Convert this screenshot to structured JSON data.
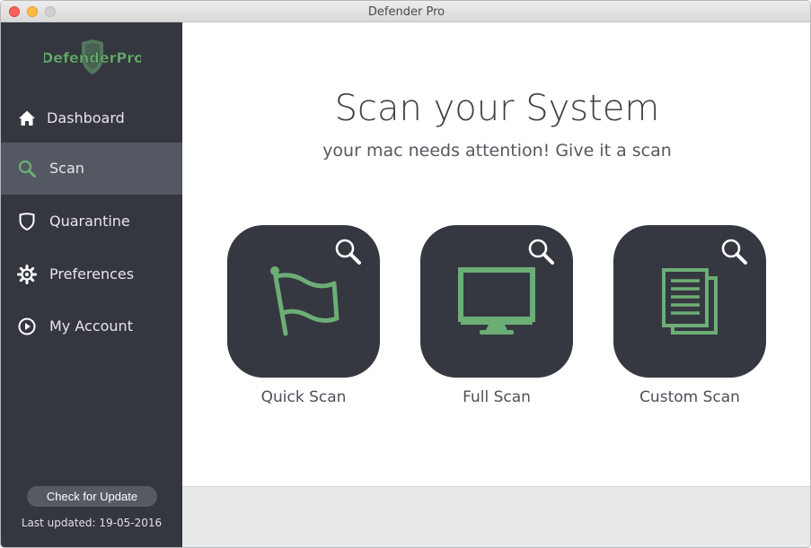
{
  "window": {
    "title": "Defender Pro"
  },
  "brand": {
    "logo_text": "DefenderPro",
    "accent_color": "#6cae75"
  },
  "sidebar": {
    "items": [
      {
        "label": "Dashboard",
        "icon": "home-icon",
        "active": false
      },
      {
        "label": "Scan",
        "icon": "search-icon",
        "active": true
      },
      {
        "label": "Quarantine",
        "icon": "shield-icon",
        "active": false
      },
      {
        "label": "Preferences",
        "icon": "gear-icon",
        "active": false
      },
      {
        "label": "My Account",
        "icon": "play-circle-icon",
        "active": false
      }
    ],
    "update_button": "Check for Update",
    "last_updated": "Last updated: 19-05-2016"
  },
  "main": {
    "title": "Scan your System",
    "subtitle": "your mac needs attention! Give it a scan",
    "scans": [
      {
        "label": "Quick Scan",
        "icon": "flag-icon"
      },
      {
        "label": "Full Scan",
        "icon": "monitor-icon"
      },
      {
        "label": "Custom Scan",
        "icon": "documents-icon"
      }
    ]
  }
}
